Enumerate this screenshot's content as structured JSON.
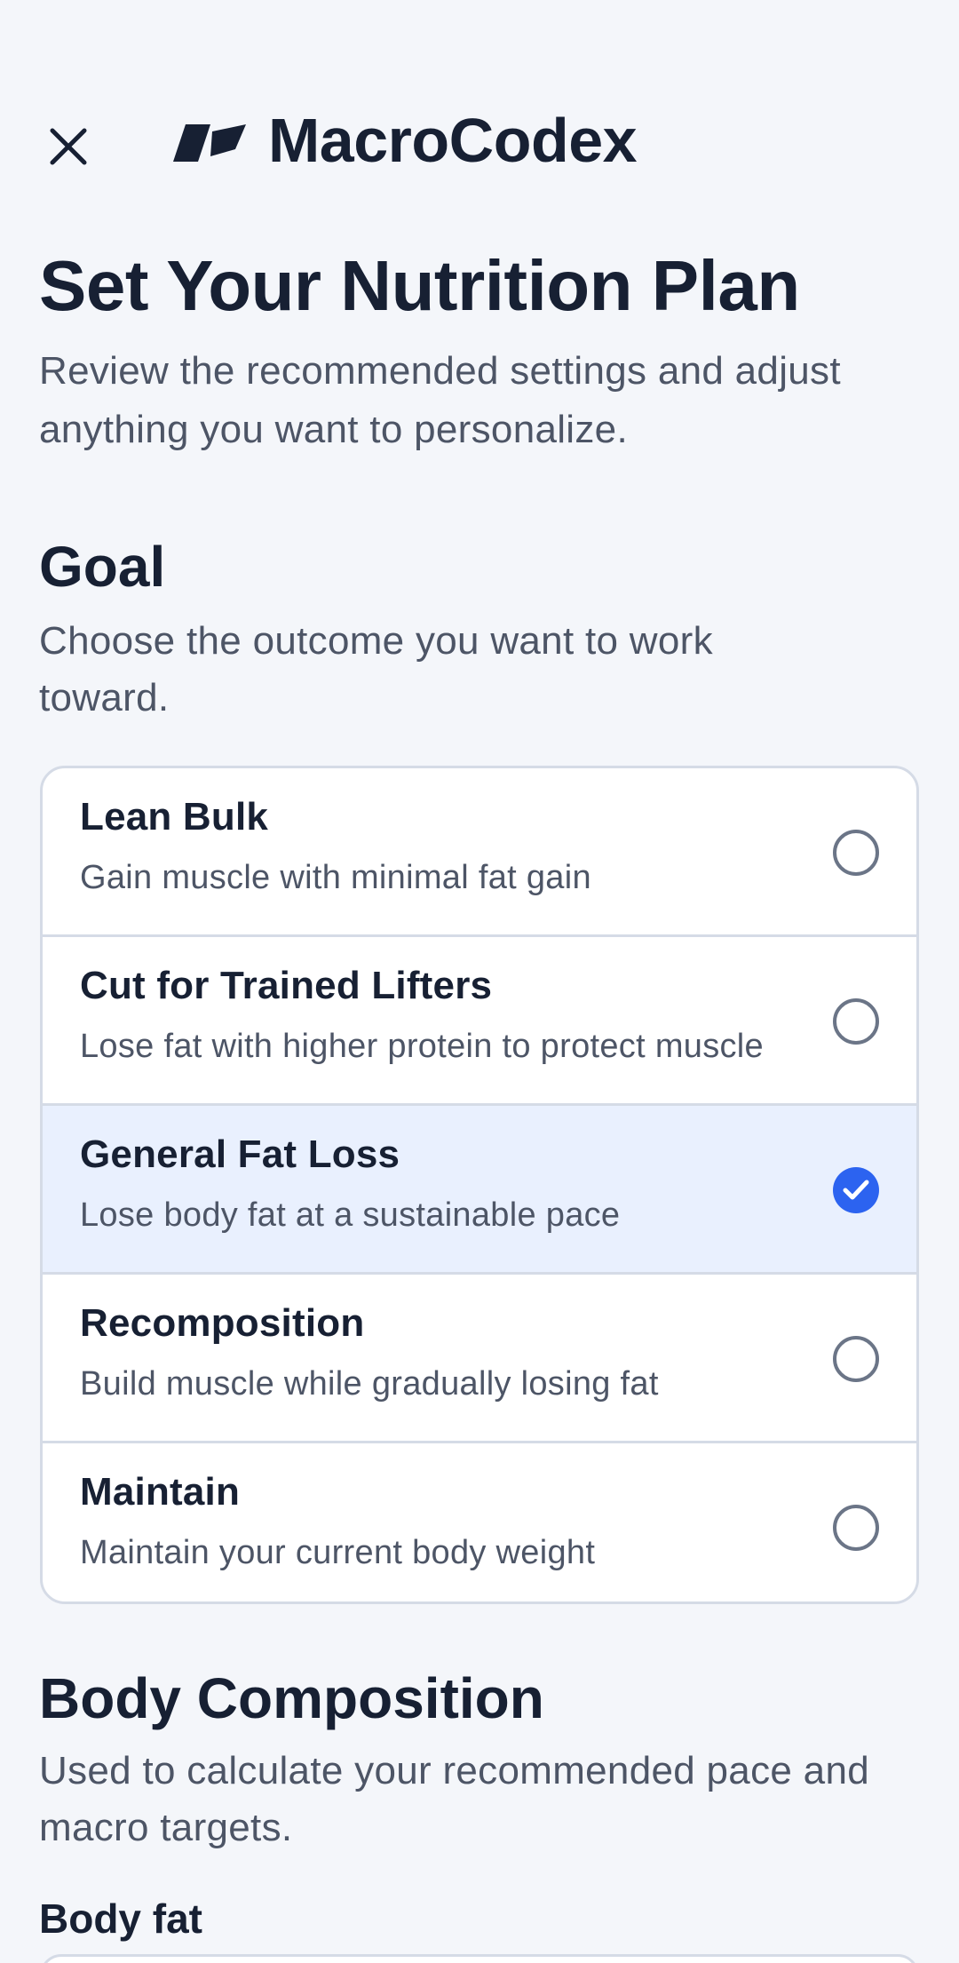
{
  "header": {
    "brand": "MacroCodex",
    "close_icon": "close-icon",
    "logo_icon": "macrocodex-logo"
  },
  "intro": {
    "title": "Set Your Nutrition Plan",
    "subtitle": "Review the recommended settings and adjust anything you want to personalize."
  },
  "goal": {
    "title": "Goal",
    "subtitle": "Choose the outcome you want to work toward.",
    "options": [
      {
        "label": "Lean Bulk",
        "description": "Gain muscle with minimal fat gain",
        "selected": false
      },
      {
        "label": "Cut for Trained Lifters",
        "description": "Lose fat with higher protein to protect muscle",
        "selected": false
      },
      {
        "label": "General Fat Loss",
        "description": "Lose body fat at a sustainable pace",
        "selected": true
      },
      {
        "label": "Recomposition",
        "description": "Build muscle while gradually losing fat",
        "selected": false
      },
      {
        "label": "Maintain",
        "description": "Maintain your current body weight",
        "selected": false
      }
    ]
  },
  "body_composition": {
    "title": "Body Composition",
    "subtitle": "Used to calculate your recommended pace and macro targets.",
    "body_fat_label": "Body fat"
  },
  "colors": {
    "accent": "#2c63f0",
    "selected_bg": "#e9f0fe",
    "text": "#172033",
    "muted": "#4d5566",
    "border": "#d5dbe6"
  }
}
